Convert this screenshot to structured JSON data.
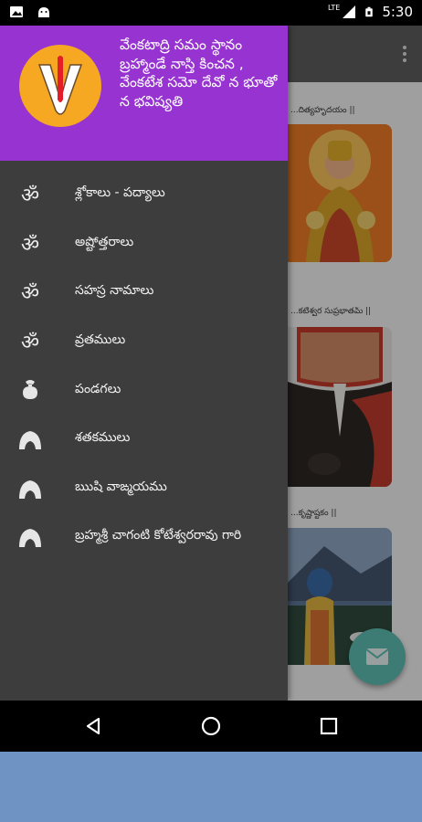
{
  "status_bar": {
    "time": "5:30",
    "network_label": "LTE",
    "icons": [
      "gallery-icon",
      "android-debug-icon",
      "signal-icon",
      "battery-icon"
    ]
  },
  "drawer": {
    "header_text": "వేంకటాద్రి సమం స్థానం బ్రహ్మాండే నాస్తి కించన , వేంకటేశ సమో దేవో న భూతో న భవిష్యతి",
    "items": [
      {
        "label": "శ్లోకాలు - పద్యాలు",
        "icon": "om-icon"
      },
      {
        "label": "అష్టోత్తరాలు",
        "icon": "om-icon"
      },
      {
        "label": "సహస్ర నామాలు",
        "icon": "om-icon"
      },
      {
        "label": "వ్రతములు",
        "icon": "om-icon"
      },
      {
        "label": "పండగలు",
        "icon": "kalash-icon"
      },
      {
        "label": "శతకములు",
        "icon": "sage-icon"
      },
      {
        "label": "ఋషి వాఙ్మయము",
        "icon": "sage-icon"
      },
      {
        "label": "బ్రహ్మశ్రీ చాగంటి కోటేశ్వరరావు గారి",
        "icon": "sage-icon"
      }
    ]
  },
  "background_cards": [
    {
      "title": "...దిత్యహృదయం ||"
    },
    {
      "title": "...కటేశ్వర సుప్రభాతమ్ ||"
    },
    {
      "title": "...కృష్ణాష్టకం ||"
    }
  ],
  "colors": {
    "drawer_header": "#9733d1",
    "drawer_bg": "#3d3d3d",
    "logo_bg": "#f6a823",
    "fab": "#5fbfb2"
  }
}
